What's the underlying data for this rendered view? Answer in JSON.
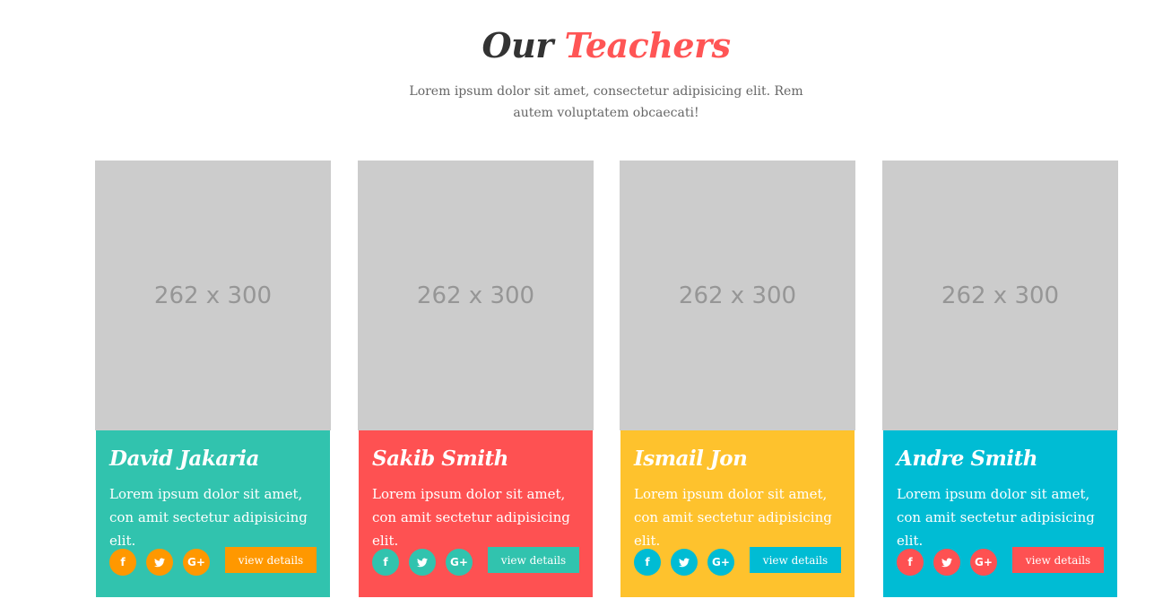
{
  "header": {
    "title_part1": "Our",
    "title_part2": "Teachers",
    "subtitle": "Lorem ipsum dolor sit amet, consectetur adipisicing elit. Rem autem voluptatem obcaecati!"
  },
  "teachers": [
    {
      "photo_placeholder": "262 x 300",
      "name": "David Jakaria",
      "description": "Lorem ipsum dolor sit amet, con amit sectetur adipisicing elit.",
      "social": [
        "f",
        "t",
        "G+"
      ],
      "button_label": "view details",
      "card_color": "#31c3ae",
      "accent_color": "#ff9800"
    },
    {
      "photo_placeholder": "262 x 300",
      "name": "Sakib Smith",
      "description": "Lorem ipsum dolor sit amet, con amit sectetur adipisicing elit.",
      "social": [
        "f",
        "t",
        "G+"
      ],
      "button_label": "view details",
      "card_color": "#fe5152",
      "accent_color": "#31c3ae"
    },
    {
      "photo_placeholder": "262 x 300",
      "name": "Ismail Jon",
      "description": "Lorem ipsum dolor sit amet, con amit sectetur adipisicing elit.",
      "social": [
        "f",
        "t",
        "G+"
      ],
      "button_label": "view details",
      "card_color": "#fec22d",
      "accent_color": "#00bcd4"
    },
    {
      "photo_placeholder": "262 x 300",
      "name": "Andre Smith",
      "description": "Lorem ipsum dolor sit amet, con amit sectetur adipisicing elit.",
      "social": [
        "f",
        "t",
        "G+"
      ],
      "button_label": "view details",
      "card_color": "#00bcd4",
      "accent_color": "#fe5152"
    }
  ],
  "icons": [
    "facebook-icon",
    "twitter-icon",
    "google-plus-icon"
  ]
}
